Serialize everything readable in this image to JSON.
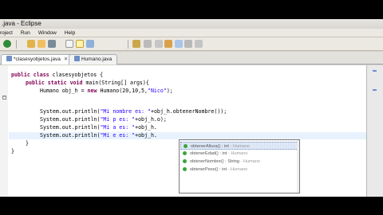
{
  "window": {
    "title": ".java - Eclipse"
  },
  "menu": [
    "roject",
    "Run",
    "Window",
    "Help"
  ],
  "toolbar": {
    "icons": [
      "gear-icon",
      "save-icon",
      "open-icon",
      "back-icon",
      "file-icon",
      "edit-icon",
      "search-icon",
      "debug-icon",
      "run-icon",
      "forward-icon",
      "new-class-icon",
      "new-package-icon",
      "open-folder-icon",
      "sync-icon",
      "refresh-icon"
    ]
  },
  "tabs": [
    {
      "label": "*clasesyobjetos.java",
      "active": true
    },
    {
      "label": "Humano.java",
      "active": false
    }
  ],
  "code": {
    "l1_kw": "public class ",
    "l1_txt": "clasesyobjetos {",
    "l2_kw": "public static void ",
    "l2_txt": "main(String[] args){",
    "l3_pre": "Humano obj_h = ",
    "l3_kw": "new ",
    "l3_txt": "Humano(20,10,5,",
    "l3_str": "\"Nico\"",
    "l3_post": ");",
    "l4_pre": "System.out.println(",
    "l4_str": "\"Mi nombre es: \"",
    "l4_post": "+obj_h.obtenerNombre());",
    "l5_pre": "System.out.println(",
    "l5_str": "\"Mi p es: \"",
    "l5_post": "+obj_h.o);",
    "l6_pre": "System.out.println(",
    "l6_str": "\"Mi a es: \"",
    "l6_post": "+obj_h.",
    "l7_pre": "System.out.println(",
    "l7_str": "\"Mi e es: \"",
    "l7_post": "+obj_h.",
    "l8": "}",
    "l9": "}"
  },
  "autocomplete": [
    {
      "name": "obtenerAltura() : int",
      "owner": " - Humano"
    },
    {
      "name": "obtenerEdad() : int",
      "owner": " - Humano"
    },
    {
      "name": "obtenerNombre() : String",
      "owner": " - Humano"
    },
    {
      "name": "obtenerPeso() : int",
      "owner": " - Humano"
    }
  ],
  "colors": {
    "keyword": "#7f0055",
    "string": "#2a00ff",
    "highlight": "#e8f2fe"
  }
}
